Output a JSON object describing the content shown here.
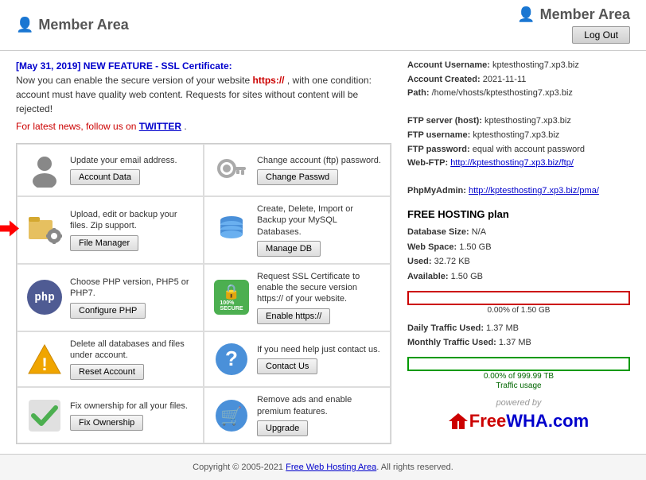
{
  "header": {
    "left_logo_text": "Member Area",
    "right_logo_text": "Member Area",
    "logout_label": "Log Out"
  },
  "announcement": {
    "date_feature": "[May 31, 2019] NEW FEATURE - SSL Certificate:",
    "line1": "Now you can enable the secure version of your website",
    "https_text": "https://",
    "line2": ", with one condition: account must have quality web content. Requests for sites without content will be rejected!",
    "news_prefix": "For latest news, follow us on ",
    "twitter": "TWITTER",
    "period": "."
  },
  "actions": [
    {
      "id": "account-data",
      "desc": "Update your email address.",
      "btn_label": "Account Data",
      "icon": "👤"
    },
    {
      "id": "change-passwd",
      "desc": "Change account (ftp) password.",
      "btn_label": "Change Passwd",
      "icon": "🔑"
    },
    {
      "id": "file-manager",
      "desc": "Upload, edit or backup your files. Zip support.",
      "btn_label": "File Manager",
      "icon": "📁",
      "has_arrow": true
    },
    {
      "id": "manage-db",
      "desc": "Create, Delete, Import or Backup your MySQL Databases.",
      "btn_label": "Manage DB",
      "icon": "🗄️"
    },
    {
      "id": "configure-php",
      "desc": "Choose PHP version, PHP5 or PHP7.",
      "btn_label": "Configure PHP",
      "icon": "php"
    },
    {
      "id": "enable-https",
      "desc": "Request SSL Certificate to enable the secure version https:// of your website.",
      "btn_label": "Enable https://",
      "icon": "🔒"
    },
    {
      "id": "reset-account",
      "desc": "Delete all databases and files under account.",
      "btn_label": "Reset Account",
      "icon": "⚠️"
    },
    {
      "id": "contact-us",
      "desc": "If you need help just contact us.",
      "btn_label": "Contact Us",
      "icon": "❓"
    },
    {
      "id": "fix-ownership",
      "desc": "Fix ownership for all your files.",
      "btn_label": "Fix Ownership",
      "icon": "✅"
    },
    {
      "id": "upgrade",
      "desc": "Remove ads and enable premium features.",
      "btn_label": "Upgrade",
      "icon": "🛒"
    }
  ],
  "account": {
    "username_label": "Account Username:",
    "username_value": "kptesthosting7.xp3.biz",
    "created_label": "Account Created:",
    "created_value": "2021-11-11",
    "path_label": "Path:",
    "path_value": "/home/vhosts/kptesthosting7.xp3.biz",
    "ftp_server_label": "FTP server (host):",
    "ftp_server_value": "kptesthosting7.xp3.biz",
    "ftp_username_label": "FTP username:",
    "ftp_username_value": "kptesthosting7.xp3.biz",
    "ftp_password_label": "FTP password:",
    "ftp_password_value": "equal with account password",
    "webftp_label": "Web-FTP:",
    "webftp_url": "http://kptesthosting7.xp3.biz/ftp/",
    "phpmyadmin_label": "PhpMyAdmin:",
    "phpmyadmin_url": "http://kptesthosting7.xp3.biz/pma/"
  },
  "plan": {
    "title": "FREE HOSTING plan",
    "db_size_label": "Database Size:",
    "db_size_value": "N/A",
    "web_space_label": "Web Space:",
    "web_space_value": "1.50 GB",
    "used_label": "Used:",
    "used_value": "32.72 KB",
    "available_label": "Available:",
    "available_value": "1.50 GB",
    "disk_progress_label": "0.00% of 1.50 GB",
    "daily_traffic_label": "Daily Traffic Used:",
    "daily_traffic_value": "1.37 MB",
    "monthly_traffic_label": "Monthly Traffic Used:",
    "monthly_traffic_value": "1.37 MB",
    "traffic_progress_label": "0.00% of 999.99 TB",
    "traffic_usage_label": "Traffic usage"
  },
  "powered_by": {
    "text": "powered by",
    "logo_free": "Free",
    "logo_wha": "WHA",
    "logo_com": ".com"
  },
  "footer": {
    "text": "Copyright © 2005-2021 ",
    "link_text": "Free Web Hosting Area",
    "text2": ". All rights reserved."
  }
}
